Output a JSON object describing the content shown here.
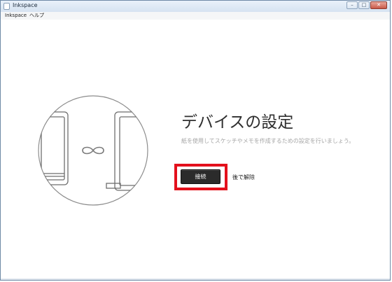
{
  "window": {
    "title": "Inkspace",
    "controls": {
      "minimize": "–",
      "maximize": "□",
      "close": "✕"
    }
  },
  "menu": [
    "Inkspace",
    "ヘルプ"
  ],
  "main": {
    "heading": "デバイスの設定",
    "description": "紙を使用してスケッチやメモを作成するための設定を行いましょう。",
    "connect_button": "接続",
    "later_link": "後で解除"
  },
  "colors": {
    "highlight": "#e3101c",
    "button_bg": "#2b2b2b",
    "heading": "#2f2f2f",
    "description": "#a5a5a5"
  },
  "icons": [
    "app-icon",
    "infinity-icon",
    "tablet-left-icon",
    "tablet-right-icon"
  ]
}
